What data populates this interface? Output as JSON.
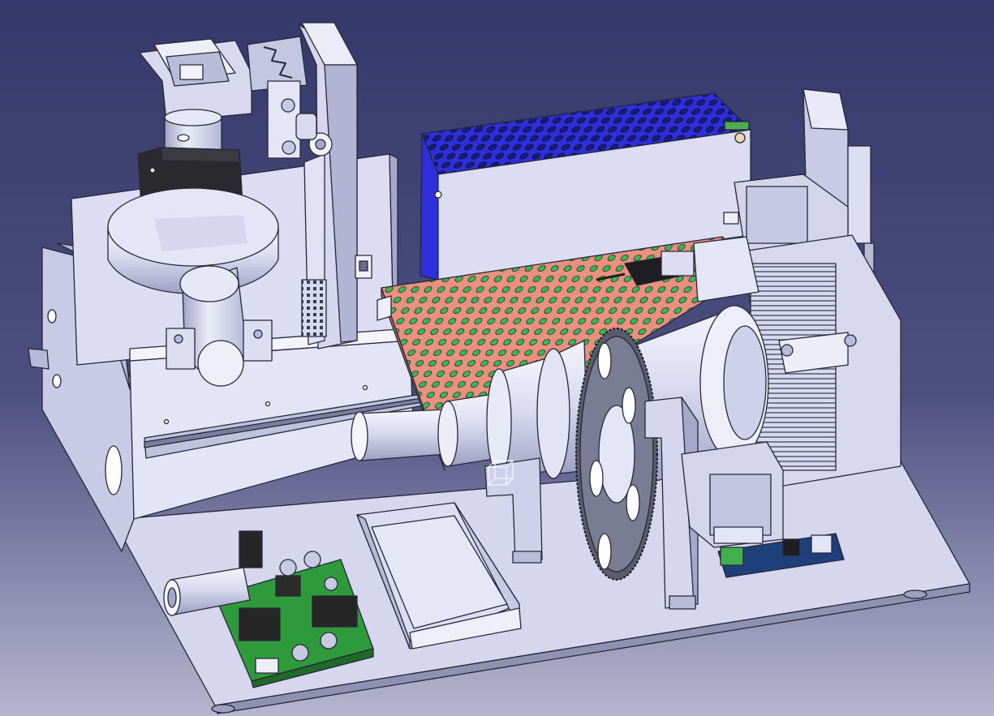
{
  "viewport": {
    "background_top": "#35386a",
    "background_bottom": "#b6b5cf"
  },
  "colors": {
    "part": "#d3d4ec",
    "part_light": "#e9eaf8",
    "part_dark": "#a6a8c9",
    "edge": "#262838",
    "pcb_green": "#2f9a3c",
    "perforated_plate": "#e8917f",
    "perforation": "#39b55a",
    "power_supply_grille": "#2d2fd8",
    "motor_block": "#2a2a2e"
  },
  "icons": {
    "compass": "selection-box-icon"
  }
}
